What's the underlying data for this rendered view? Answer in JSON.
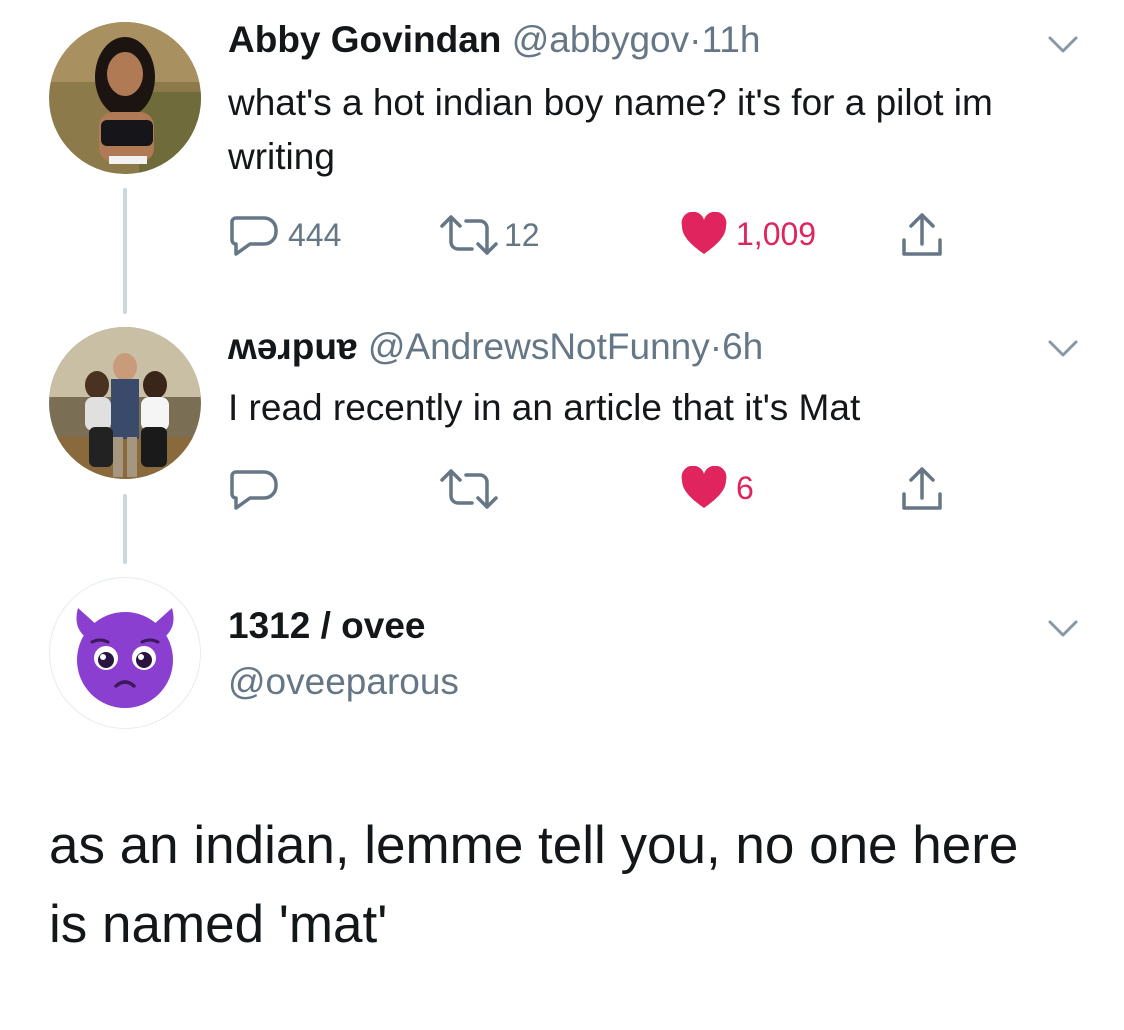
{
  "tweets": [
    {
      "name": "Abby Govindan",
      "handle": "@abbygov",
      "separator": "·",
      "time": "11h",
      "text": "what's a hot indian boy name? it's for a pilot im writing",
      "replies": "444",
      "retweets": "12",
      "likes": "1,009"
    },
    {
      "name": "ʍǝɹpuɐ",
      "handle": "@AndrewsNotFunny",
      "separator": "·",
      "time": "6h",
      "text": "I read recently in an article that it's Mat",
      "replies": "",
      "retweets": "",
      "likes": "6"
    }
  ],
  "main_tweet": {
    "name": "1312 / ovee",
    "handle": "@oveeparous",
    "text": "as an indian, lemme tell you, no one here is named 'mat'"
  },
  "colors": {
    "like": "#e0245e",
    "secondary": "#657786",
    "thread_line": "#ccd6dd",
    "avatar_purple": "#8a3fd1"
  }
}
